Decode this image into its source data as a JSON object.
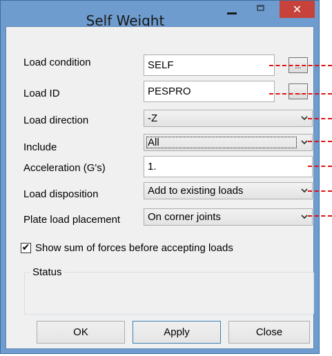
{
  "window": {
    "title": "Self Weight",
    "close_glyph": "✕"
  },
  "form": {
    "load_condition": {
      "label": "Load condition",
      "value": "SELF",
      "browse": "..."
    },
    "load_id": {
      "label": "Load ID",
      "value": "PESPRO",
      "browse": "..."
    },
    "load_direction": {
      "label": "Load direction",
      "value": "-Z"
    },
    "include": {
      "label": "Include",
      "value": "All"
    },
    "acceleration": {
      "label": "Acceleration (G's)",
      "value": "1."
    },
    "load_disposition": {
      "label": "Load disposition",
      "value": "Add to existing loads"
    },
    "plate_load_placement": {
      "label": "Plate load placement",
      "value": "On corner joints"
    }
  },
  "show_sum": {
    "label": "Show sum of forces before accepting loads",
    "checked": true,
    "check_glyph": "✔"
  },
  "status": {
    "label": "Status",
    "text": ""
  },
  "buttons": {
    "ok": "OK",
    "apply": "Apply",
    "close": "Close"
  },
  "icons": {
    "minimize": "minimize-icon",
    "maximize": "maximize-icon",
    "close": "close-icon",
    "dropdown": "chevron-down-icon",
    "check": "checkmark-icon"
  },
  "colors": {
    "title_bar": "#6e9cce",
    "close_button": "#c7423a",
    "annotation_lines": "#e01010",
    "dialog_bg": "#f0f0f0"
  }
}
